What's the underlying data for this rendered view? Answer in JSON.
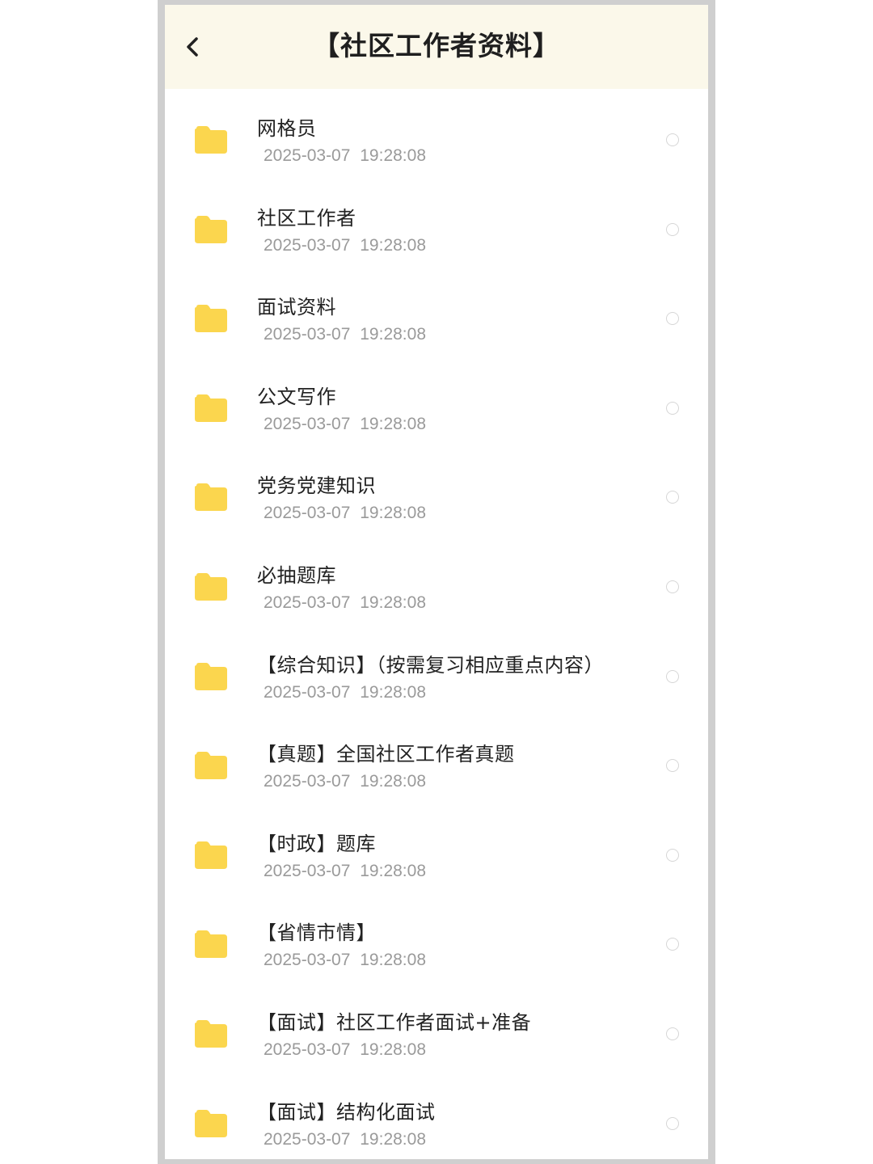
{
  "header": {
    "title": "【社区工作者资料】",
    "back_icon": "chevron-left-icon"
  },
  "colors": {
    "header_bg": "#fbf8ea",
    "folder": "#fbd64e",
    "date_text": "#9a9a9a"
  },
  "items": [
    {
      "name": "网格员",
      "date": "2025-03-07 19:28:08",
      "icon": "folder-icon"
    },
    {
      "name": "社区工作者",
      "date": "2025-03-07 19:28:08",
      "icon": "folder-icon"
    },
    {
      "name": "面试资料",
      "date": "2025-03-07 19:28:08",
      "icon": "folder-icon"
    },
    {
      "name": "公文写作",
      "date": "2025-03-07 19:28:08",
      "icon": "folder-icon"
    },
    {
      "name": "党务党建知识",
      "date": "2025-03-07 19:28:08",
      "icon": "folder-icon"
    },
    {
      "name": "必抽题库",
      "date": "2025-03-07 19:28:08",
      "icon": "folder-icon"
    },
    {
      "name": "【综合知识】（按需复习相应重点内容）",
      "date": "2025-03-07 19:28:08",
      "icon": "folder-icon"
    },
    {
      "name": "【真题】全国社区工作者真题",
      "date": "2025-03-07 19:28:08",
      "icon": "folder-icon"
    },
    {
      "name": "【时政】题库",
      "date": "2025-03-07 19:28:08",
      "icon": "folder-icon"
    },
    {
      "name": "【省情市情】",
      "date": "2025-03-07 19:28:08",
      "icon": "folder-icon"
    },
    {
      "name": "【面试】社区工作者面试+准备",
      "date": "2025-03-07 19:28:08",
      "icon": "folder-icon"
    },
    {
      "name": "【面试】结构化面试",
      "date": "2025-03-07 19:28:08",
      "icon": "folder-icon"
    }
  ]
}
